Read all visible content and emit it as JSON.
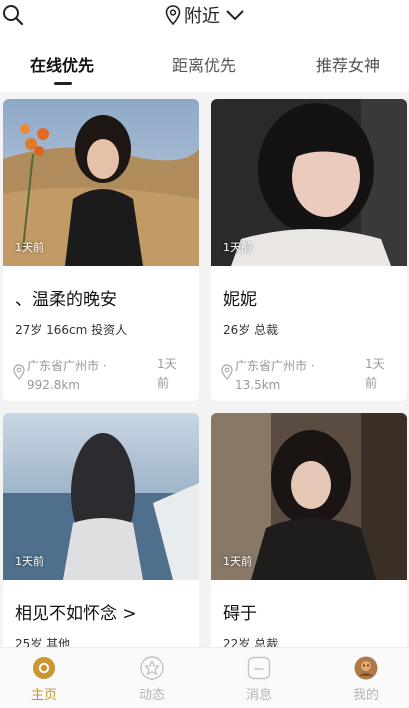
{
  "header": {
    "location": "附近",
    "icons": {
      "search": "search-icon",
      "location": "map-pin-icon",
      "dropdown": "chevron-down-icon"
    }
  },
  "tabs": [
    {
      "label": "在线优先",
      "active": true
    },
    {
      "label": "距离优先",
      "active": false
    },
    {
      "label": "推荐女神",
      "active": false
    }
  ],
  "cards": [
    {
      "name": "、温柔的晚安",
      "meta": "27岁  166cm  投资人",
      "location": "广东省广州市 · 992.8km",
      "ago": "1天前",
      "photo_time": "1天前"
    },
    {
      "name": "妮妮",
      "meta": "26岁  总裁",
      "location": "广东省广州市 · 13.5km",
      "ago": "1天前",
      "photo_time": "1天前"
    },
    {
      "name": "相见不如怀念 >",
      "meta": "25岁  其他",
      "photo_time": "1天前"
    },
    {
      "name": "碍于",
      "meta": "22岁  总裁",
      "photo_time": "1天前"
    }
  ],
  "bottom_nav": [
    {
      "label": "主页",
      "icon": "home-icon",
      "active": true
    },
    {
      "label": "动态",
      "icon": "star-icon",
      "active": false
    },
    {
      "label": "消息",
      "icon": "message-icon",
      "active": false
    },
    {
      "label": "我的",
      "icon": "avatar-icon",
      "active": false
    }
  ],
  "colors": {
    "accent": "#c9962f",
    "inactive": "#b5b5b5",
    "background": "#f3f3f3"
  }
}
